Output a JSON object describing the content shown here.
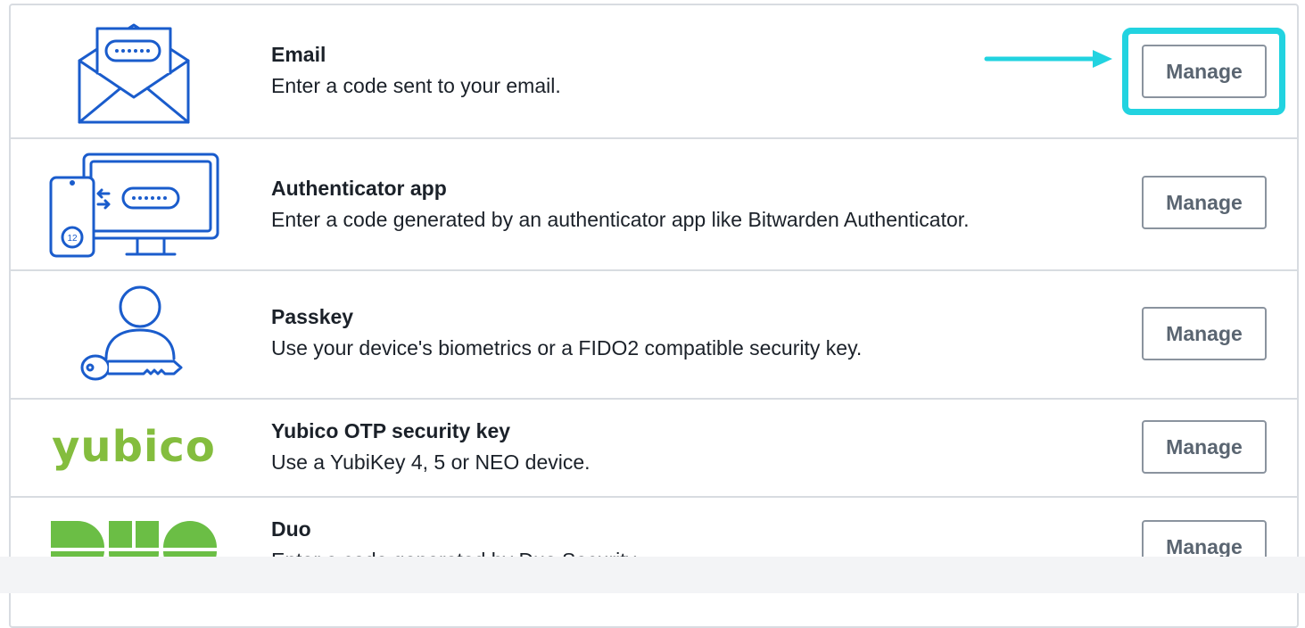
{
  "methods": [
    {
      "key": "email",
      "title": "Email",
      "description": "Enter a code sent to your email.",
      "manage_label": "Manage",
      "icon": "email-icon"
    },
    {
      "key": "authenticator",
      "title": "Authenticator app",
      "description": "Enter a code generated by an authenticator app like Bitwarden Authenticator.",
      "manage_label": "Manage",
      "icon": "authenticator-app-icon"
    },
    {
      "key": "passkey",
      "title": "Passkey",
      "description": "Use your device's biometrics or a FIDO2 compatible security key.",
      "manage_label": "Manage",
      "icon": "passkey-icon"
    },
    {
      "key": "yubico",
      "title": "Yubico OTP security key",
      "description": "Use a YubiKey 4, 5 or NEO device.",
      "manage_label": "Manage",
      "logo_text": "yubico"
    },
    {
      "key": "duo",
      "title": "Duo",
      "description": "Enter a code generated by Duo Security.",
      "manage_label": "Manage",
      "logo_text": "DUO"
    }
  ],
  "colors": {
    "icon_blue": "#1a5ccc",
    "highlight_cyan": "#22d3e0",
    "yubico_green": "#84bd3e",
    "duo_green": "#6bbe45",
    "border": "#d8dce1",
    "button_text": "#5a6571"
  },
  "annotation": {
    "highlighted_method": "email",
    "highlight_shape": "rounded-rectangle",
    "arrow_direction": "right"
  }
}
